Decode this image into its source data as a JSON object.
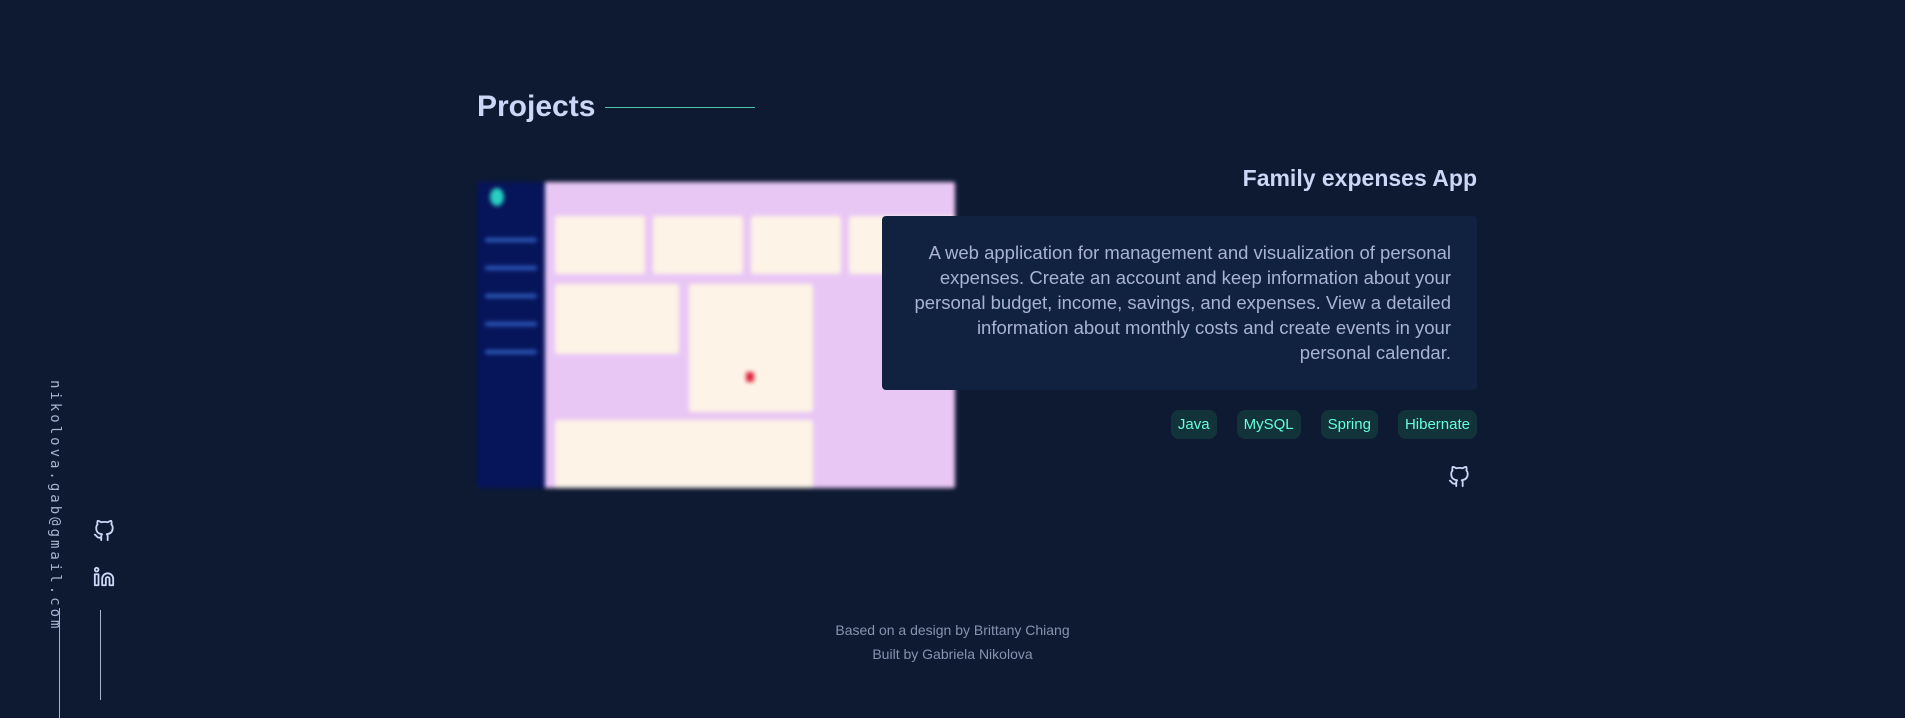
{
  "email": "nikolova.gab@gmail.com",
  "section": {
    "title": "Projects"
  },
  "project": {
    "title": "Family expenses App",
    "description": "A web application for management and visualization of personal expenses. Create an account and keep information about your personal budget, income, savings, and expenses. View a detailed information about monthly costs and create events in your personal calendar.",
    "tech": [
      "Java",
      "MySQL",
      "Spring",
      "Hibernate"
    ],
    "link_icon": "github-icon"
  },
  "social": {
    "icons": [
      "github-icon",
      "linkedin-icon"
    ]
  },
  "footer": {
    "line1": "Based on a design by Brittany Chiang",
    "line2": "Built by Gabriela Nikolova"
  },
  "colors": {
    "background": "#0e1a32",
    "card": "#112240",
    "accent": "#64ffda",
    "heading": "#ccd6f6",
    "text": "#a8b2d1"
  }
}
